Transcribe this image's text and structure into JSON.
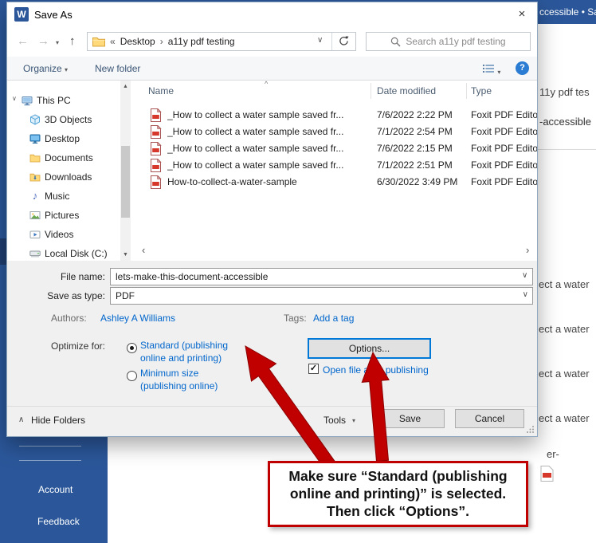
{
  "colors": {
    "word_blue": "#2b579a",
    "link_blue": "#0066cc",
    "callout_red": "#c00000",
    "focus_blue": "#0078d7"
  },
  "background": {
    "titlebar_fragment": "ccessible • Sa",
    "folder_header_fragment": "11y pdf tes",
    "doc_name_fragment": "-accessible",
    "list_fragments": [
      "ect a water",
      "ect a water",
      "ect a water",
      "ect a water"
    ],
    "small_fragment": "er-",
    "sidebar": {
      "account": "Account",
      "feedback": "Feedback"
    }
  },
  "dialog": {
    "title": "Save As",
    "nav": {
      "breadcrumb_root": "Desktop",
      "breadcrumb_current": "a11y pdf testing",
      "search_placeholder": "Search a11y pdf testing"
    },
    "toolbar": {
      "organize": "Organize",
      "new_folder": "New folder"
    },
    "tree": [
      "This PC",
      "3D Objects",
      "Desktop",
      "Documents",
      "Downloads",
      "Music",
      "Pictures",
      "Videos",
      "Local Disk (C:)"
    ],
    "list": {
      "col_name": "Name",
      "col_date": "Date modified",
      "col_type": "Type",
      "rows": [
        {
          "name": "_How to collect a water sample saved fr...",
          "date": "7/6/2022 2:22 PM",
          "type": "Foxit PDF Editor"
        },
        {
          "name": "_How to collect a water sample saved fr...",
          "date": "7/1/2022 2:54 PM",
          "type": "Foxit PDF Editor"
        },
        {
          "name": "_How to collect a water sample saved fr...",
          "date": "7/6/2022 2:15 PM",
          "type": "Foxit PDF Editor"
        },
        {
          "name": "_How to collect a water sample saved fr...",
          "date": "7/1/2022 2:51 PM",
          "type": "Foxit PDF Editor"
        },
        {
          "name": "How-to-collect-a-water-sample",
          "date": "6/30/2022 3:49 PM",
          "type": "Foxit PDF Editor"
        }
      ]
    },
    "fields": {
      "file_name_label": "File name:",
      "file_name_value": "lets-make-this-document-accessible",
      "save_type_label": "Save as type:",
      "save_type_value": "PDF",
      "authors_label": "Authors:",
      "authors_value": "Ashley A Williams",
      "tags_label": "Tags:",
      "tags_value": "Add a tag",
      "optimize_label": "Optimize for:",
      "radio_standard_line1": "Standard (publishing",
      "radio_standard_line2": "online and printing)",
      "radio_minimum_line1": "Minimum size",
      "radio_minimum_line2": "(publishing online)",
      "options_button": "Options...",
      "open_after_label": "Open file after publishing"
    },
    "footer": {
      "hide_folders": "Hide Folders",
      "tools": "Tools",
      "save": "Save",
      "cancel": "Cancel"
    }
  },
  "callout": {
    "line1": "Make sure “Standard (publishing",
    "line2": "online and printing)” is selected.",
    "line3": "Then click “Options”."
  },
  "icons": {
    "word_badge": "W",
    "close": "×",
    "back": "←",
    "forward": "→",
    "nav_dropdown": "▾",
    "up": "↑",
    "breadcrumb_root_chevrons": "«",
    "breadcrumb_sep": "›",
    "address_dropdown": "∨",
    "organize_dropdown": "▾",
    "view_dropdown": "▾",
    "help": "?",
    "sort_indicator": "^",
    "scroll_up": "▲",
    "scroll_down": "▼",
    "scroll_left": "‹",
    "scroll_right": "›",
    "combo_dropdown": "∨",
    "check": "✓",
    "hide_folders_chevron": "∧",
    "tools_dropdown": "▾",
    "tree_expand": "∨"
  }
}
